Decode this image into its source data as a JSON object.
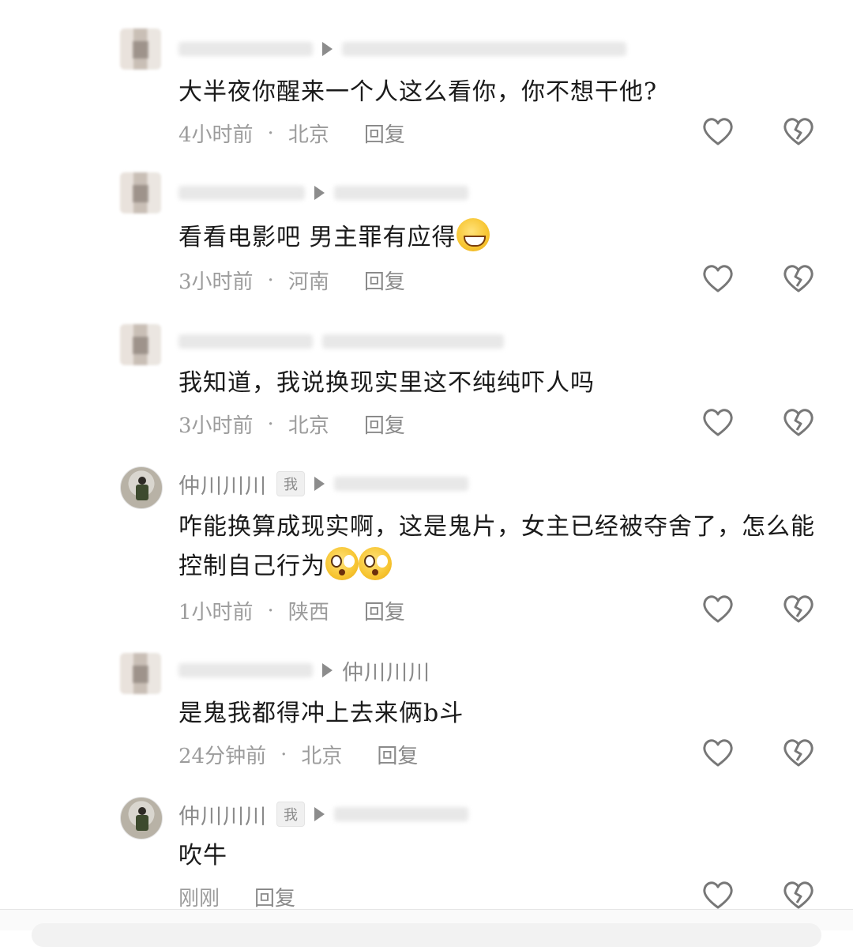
{
  "comments": [
    {
      "text": "大半夜你醒来一个人这么看你，你不想干他?",
      "time": "4小时前",
      "location": "北京",
      "reply": "回复"
    },
    {
      "text": "看看电影吧 男主罪有应得",
      "emoji": "grinning-sweat",
      "time": "3小时前",
      "location": "河南",
      "reply": "回复"
    },
    {
      "text": "我知道，我说换现实里这不纯纯吓人吗",
      "time": "3小时前",
      "location": "北京",
      "reply": "回复"
    },
    {
      "username": "仲川川川",
      "me_tag": "我",
      "text": "咋能换算成现实啊，这是鬼片，女主已经被夺舍了，怎么能控制自己行为",
      "emoji": "flushed",
      "time": "1小时前",
      "location": "陕西",
      "reply": "回复"
    },
    {
      "reply_to": "仲川川川",
      "text": "是鬼我都得冲上去来俩b斗",
      "time": "24分钟前",
      "location": "北京",
      "reply": "回复"
    },
    {
      "username": "仲川川川",
      "me_tag": "我",
      "text": "吹牛",
      "time": "刚刚",
      "reply": "回复"
    }
  ],
  "icons": {
    "like": "heart-icon",
    "dislike": "broken-heart-icon"
  },
  "colors": {
    "meta": "#9c9c9c",
    "text": "#1a1a1a",
    "icon": "#777777"
  }
}
